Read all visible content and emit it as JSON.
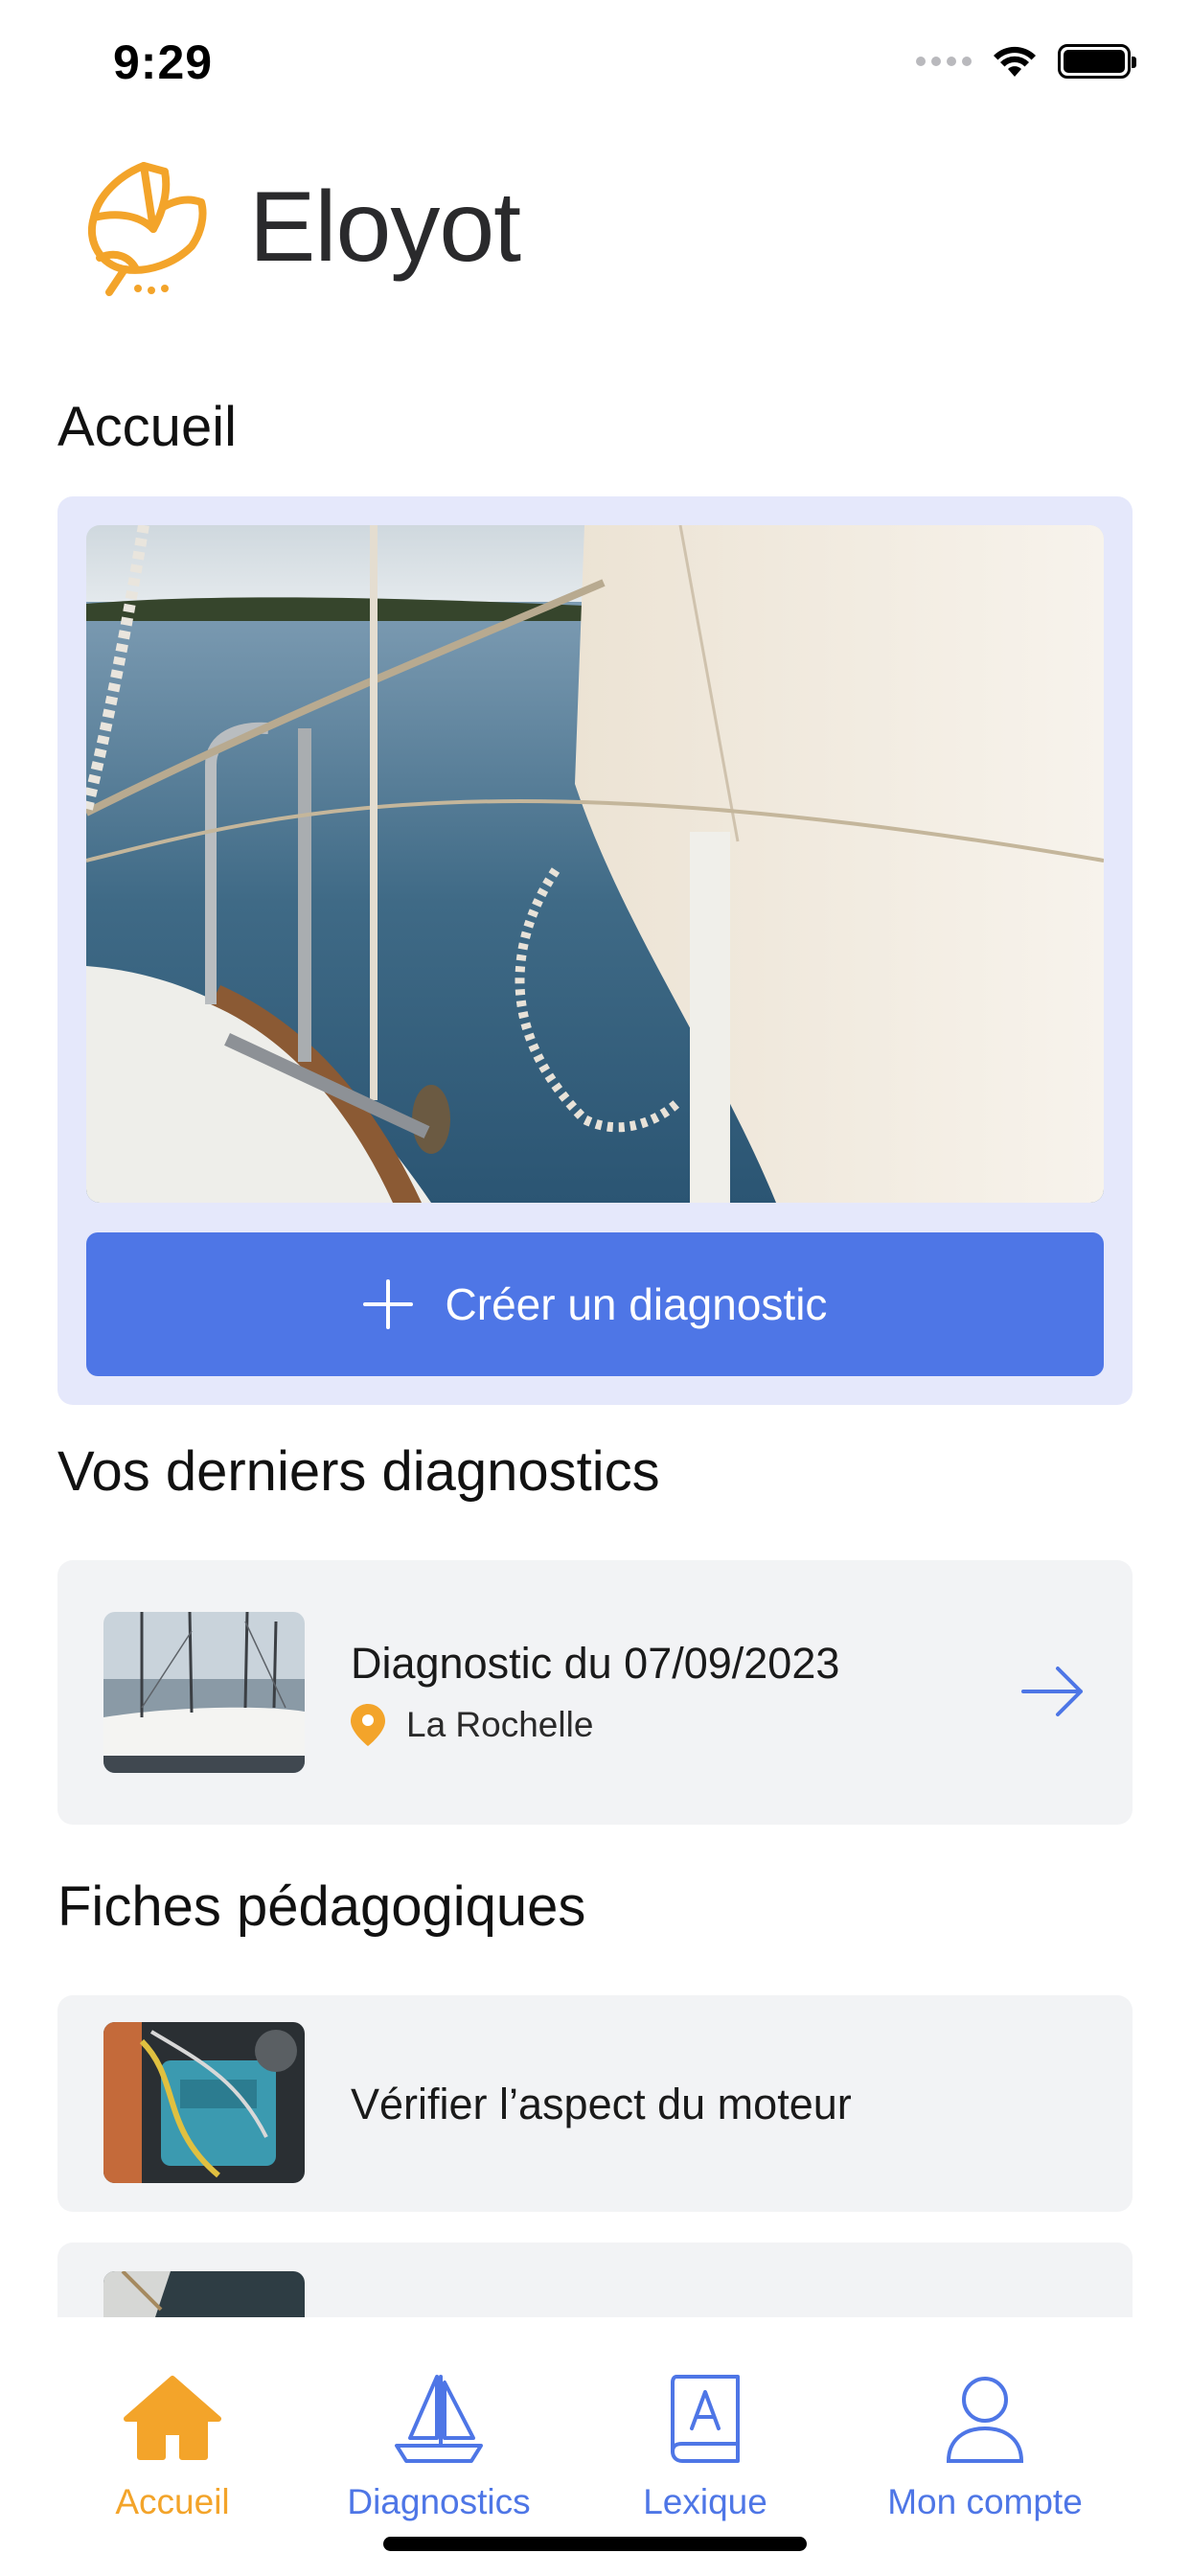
{
  "status_bar": {
    "time": "9:29"
  },
  "app": {
    "title": "Eloyot",
    "logo_icon": "paper-boat-logo-icon",
    "accent_color": "#f3a42a",
    "primary_color": "#4e76e6"
  },
  "home": {
    "section_title": "Accueil",
    "create_button_label": "Créer un diagnostic",
    "create_icon": "plus-icon"
  },
  "recent": {
    "section_title": "Vos derniers diagnostics",
    "items": [
      {
        "title": "Diagnostic du 07/09/2023",
        "location": "La Rochelle",
        "location_icon": "map-pin-icon",
        "action_icon": "arrow-right-icon"
      }
    ]
  },
  "fiches": {
    "section_title": "Fiches pédagogiques",
    "items": [
      {
        "title": "Vérifier l’aspect du moteur"
      },
      {
        "title": ""
      }
    ]
  },
  "tab_bar": {
    "tabs": [
      {
        "label": "Accueil",
        "icon": "home-icon",
        "active": true
      },
      {
        "label": "Diagnostics",
        "icon": "sailboat-icon",
        "active": false
      },
      {
        "label": "Lexique",
        "icon": "book-icon",
        "active": false
      },
      {
        "label": "Mon compte",
        "icon": "user-icon",
        "active": false
      }
    ]
  }
}
